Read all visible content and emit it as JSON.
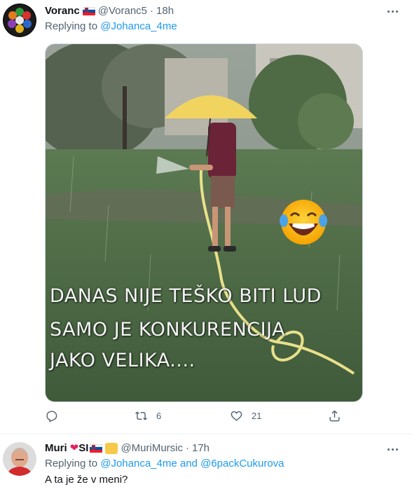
{
  "tweets": [
    {
      "author": "Voranc",
      "handle": "@Voranc5",
      "separator": "·",
      "time": "18h",
      "replying_prefix": "Replying to",
      "replying_to": "@Johanca_4me",
      "media": {
        "lines": [
          "DANAS NIJE TEŠKO BITI LUD",
          "SAMO JE KONKURENCIJA",
          "JAKO VELIKA...."
        ]
      },
      "actions": {
        "reply_count": "",
        "retweet_count": "6",
        "like_count": "21"
      }
    },
    {
      "author": "Muri",
      "author_suffix": "SI",
      "handle": "@MuriMursic",
      "separator": "·",
      "time": "17h",
      "replying_prefix": "Replying to",
      "replying_to": "@Johanca_4me",
      "replying_joiner": "and",
      "replying_to_2": "@6packCukurova",
      "text": "A ta je že v meni?"
    }
  ],
  "icons": {
    "reply": "reply-icon",
    "retweet": "retweet-icon",
    "like": "heart-icon",
    "share": "share-icon",
    "more": "more-icon"
  },
  "colors": {
    "link": "#1d9bf0",
    "secondary_text": "#536471",
    "primary_text": "#0f1419"
  }
}
